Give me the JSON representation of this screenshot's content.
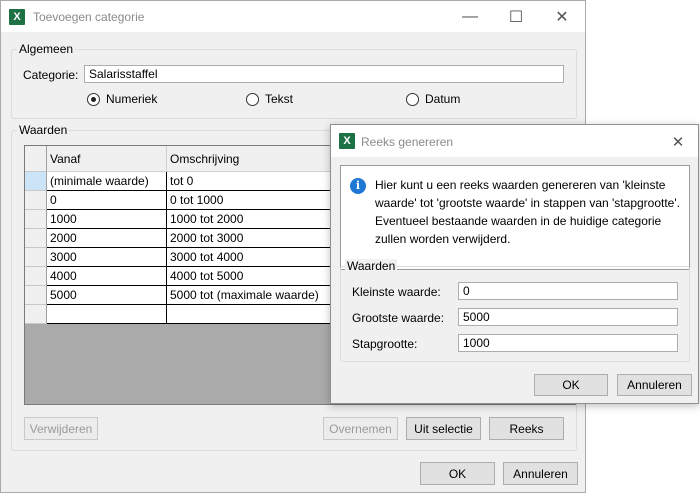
{
  "main_window": {
    "title": "Toevoegen categorie",
    "app_icon": "X",
    "general_group": {
      "legend": "Algemeen",
      "category_label": "Categorie:",
      "category_value": "Salarisstaffel",
      "radios": [
        {
          "label": "Numeriek",
          "selected": true
        },
        {
          "label": "Tekst",
          "selected": false
        },
        {
          "label": "Datum",
          "selected": false
        }
      ]
    },
    "values_group": {
      "legend": "Waarden",
      "columns": [
        "Vanaf",
        "Omschrijving"
      ],
      "rows": [
        [
          "(minimale waarde)",
          "tot 0"
        ],
        [
          "0",
          "0 tot 1000"
        ],
        [
          "1000",
          "1000 tot 2000"
        ],
        [
          "2000",
          "2000 tot 3000"
        ],
        [
          "3000",
          "3000 tot 4000"
        ],
        [
          "4000",
          "4000 tot 5000"
        ],
        [
          "5000",
          "5000 tot (maximale waarde)"
        ],
        [
          "",
          ""
        ]
      ]
    },
    "buttons": {
      "delete": "Verwijderen",
      "take_over": "Overnemen",
      "from_selection": "Uit selectie",
      "series": "Reeks",
      "ok": "OK",
      "cancel": "Annuleren"
    }
  },
  "dialog": {
    "title": "Reeks genereren",
    "app_icon": "X",
    "info_icon": "i",
    "info_text": "Hier kunt u een reeks waarden genereren van 'kleinste waarde' tot 'grootste waarde' in stappen van 'stapgrootte'. Eventueel bestaande waarden in de huidige categorie zullen worden verwijderd.",
    "group": {
      "legend": "Waarden",
      "fields": [
        {
          "label": "Kleinste waarde:",
          "value": "0"
        },
        {
          "label": "Grootste waarde:",
          "value": "5000"
        },
        {
          "label": "Stapgrootte:",
          "value": "1000"
        }
      ]
    },
    "buttons": {
      "ok": "OK",
      "cancel": "Annuleren"
    }
  }
}
